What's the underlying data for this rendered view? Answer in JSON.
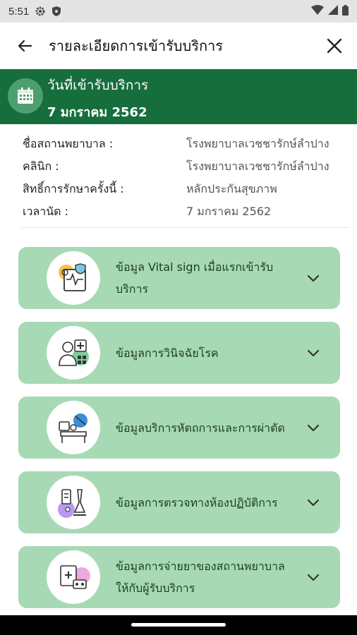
{
  "status_bar": {
    "time": "5:51"
  },
  "header": {
    "title": "รายละเอียดการเข้ารับบริการ"
  },
  "banner": {
    "label": "วันที่เข้ารับบริการ",
    "date": "7 มกราคม 2562"
  },
  "info": [
    {
      "key": "ชื่อสถานพยาบาล :",
      "value": "โรงพยาบาลเวชชารักษ์ลำปาง"
    },
    {
      "key": "คลินิก :",
      "value": "โรงพยาบาลเวชชารักษ์ลำปาง"
    },
    {
      "key": "สิทธิ์การรักษาครั้งนี้ :",
      "value": "หลักประกันสุขภาพ"
    },
    {
      "key": "เวลานัด :",
      "value": "7 มกราคม 2562"
    }
  ],
  "cards": [
    {
      "label": "ข้อมูล Vital sign เมื่อแรกเข้ารับบริการ",
      "icon": "vital-sign-icon"
    },
    {
      "label": "ข้อมูลการวินิจฉัยโรค",
      "icon": "diagnosis-icon"
    },
    {
      "label": "ข้อมูลบริการหัตถการและการผ่าตัด",
      "icon": "procedure-icon"
    },
    {
      "label": "ข้อมูลการตรวจทางห้องปฏิบัติการ",
      "icon": "lab-icon"
    },
    {
      "label": "ข้อมูลการจ่ายยาของสถานพยาบาลให้กับผู้รับบริการ",
      "icon": "medication-icon"
    }
  ],
  "colors": {
    "banner": "#176e3d",
    "card": "#a8d9b5",
    "status_bar": "#e4e4e4"
  }
}
